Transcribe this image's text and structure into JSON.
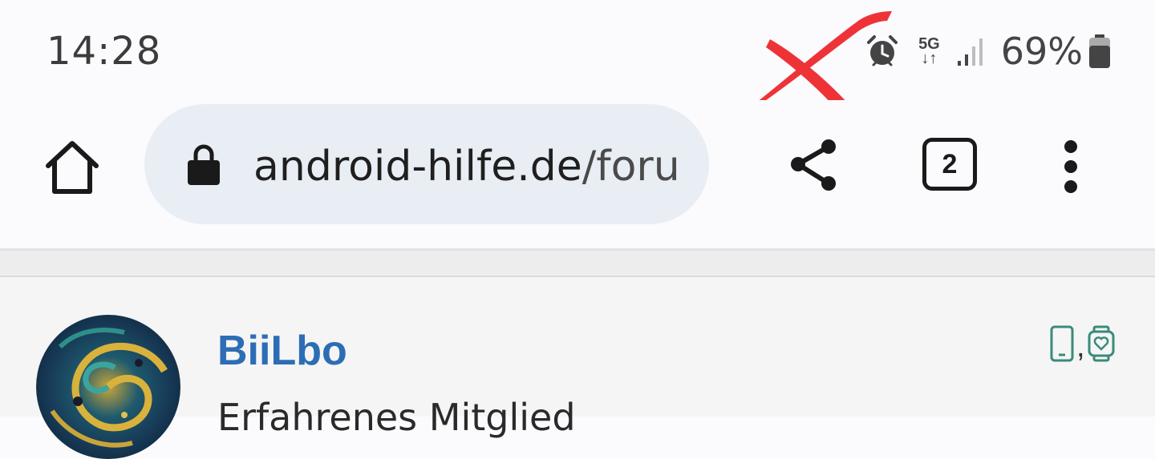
{
  "status_bar": {
    "time": "14:28",
    "network_top": "5G",
    "network_bottom": "↓↑",
    "battery_percent": "69%",
    "icons": [
      "alarm-icon",
      "network-5g-icon",
      "signal-icon",
      "battery-icon"
    ]
  },
  "browser": {
    "url_domain": "android-hilfe.de",
    "url_path": "/foru",
    "tab_count": "2",
    "icons": [
      "home-icon",
      "lock-icon",
      "share-icon",
      "tabs-icon",
      "more-vert-icon"
    ]
  },
  "post": {
    "username": "BiiLbo",
    "rank": "Erfahrenes Mitglied",
    "device_separator": ",",
    "device_icons": [
      "smartphone-icon",
      "smartwatch-icon"
    ]
  },
  "colors": {
    "username": "#2d6db5",
    "url_pill": "#e8eef3",
    "device_icon": "#3b8a7a",
    "scribble": "#ee3338"
  }
}
